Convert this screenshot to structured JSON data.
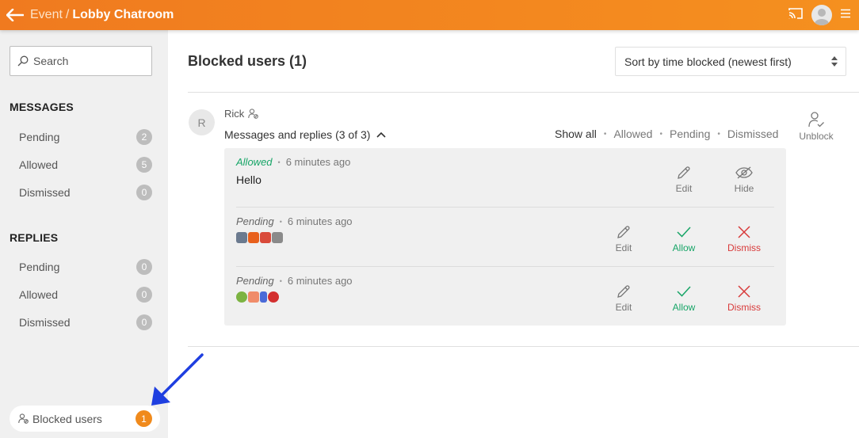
{
  "header": {
    "breadcrumb_parent": "Event",
    "separator": "/",
    "title": "Lobby Chatroom",
    "icons": [
      "back-arrow-icon",
      "cast-icon",
      "account-avatar-icon",
      "menu-icon"
    ]
  },
  "sidebar": {
    "search_placeholder": "Search",
    "messages_title": "MESSAGES",
    "messages_items": [
      {
        "label": "Pending",
        "count": "2"
      },
      {
        "label": "Allowed",
        "count": "5"
      },
      {
        "label": "Dismissed",
        "count": "0"
      }
    ],
    "replies_title": "REPLIES",
    "replies_items": [
      {
        "label": "Pending",
        "count": "0"
      },
      {
        "label": "Allowed",
        "count": "0"
      },
      {
        "label": "Dismissed",
        "count": "0"
      }
    ],
    "blocked_label": "Blocked users",
    "blocked_count": "1"
  },
  "main": {
    "title": "Blocked users (1)",
    "sort_value": "Sort by time blocked (newest first)",
    "user": {
      "initial": "R",
      "name": "Rick",
      "thread_title": "Messages and replies (3 of 3)",
      "unblock_label": "Unblock"
    },
    "filters": [
      "Show all",
      "Allowed",
      "Pending",
      "Dismissed"
    ],
    "filter_separator": "•",
    "messages": [
      {
        "status": "Allowed",
        "time": "6 minutes ago",
        "text": "Hello",
        "actions": [
          "Edit",
          "Hide"
        ]
      },
      {
        "status": "Pending",
        "time": "6 minutes ago",
        "emoji": [
          "#6b7a8f",
          "#e8601c",
          "#d94a3a",
          "#8a8a8a"
        ],
        "actions": [
          "Edit",
          "Allow",
          "Dismiss"
        ]
      },
      {
        "status": "Pending",
        "time": "6 minutes ago",
        "emoji": [
          "#7cb342",
          "#f08c6a",
          "#4a6ad8",
          "#d32f2f"
        ],
        "actions": [
          "Edit",
          "Allow",
          "Dismiss"
        ]
      }
    ]
  },
  "annotation": {
    "arrow_color": "#1f3fe0"
  }
}
